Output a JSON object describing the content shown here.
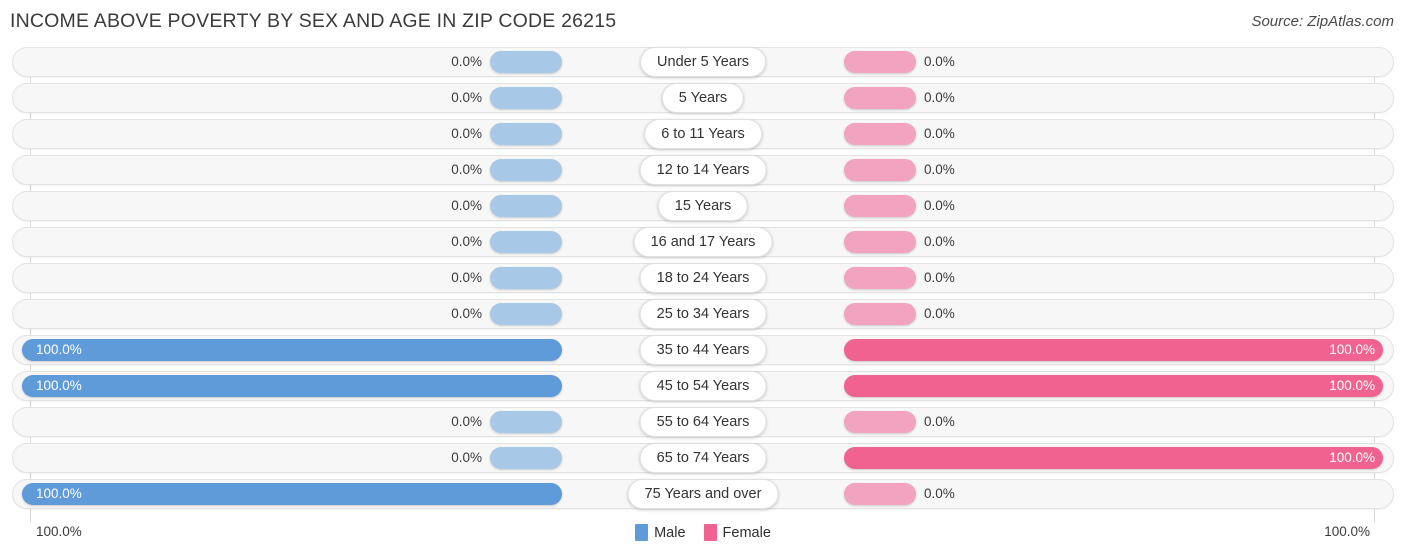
{
  "header": {
    "title": "INCOME ABOVE POVERTY BY SEX AND AGE IN ZIP CODE 26215",
    "source": "Source: ZipAtlas.com"
  },
  "legend": {
    "male_label": "Male",
    "female_label": "Female",
    "male_color": "#5f9bd9",
    "female_color": "#f0628f",
    "male_zero_color": "#a8c8e8",
    "female_zero_color": "#f2a3bf"
  },
  "axis": {
    "left_label": "100.0%",
    "right_label": "100.0%",
    "max": 100.0
  },
  "chart_data": {
    "type": "bar",
    "orientation": "horizontal-diverging",
    "title": "INCOME ABOVE POVERTY BY SEX AND AGE IN ZIP CODE 26215",
    "xlabel": "",
    "ylabel": "",
    "xlim": [
      0,
      100
    ],
    "grid": true,
    "legend_position": "bottom-center",
    "categories": [
      "Under 5 Years",
      "5 Years",
      "6 to 11 Years",
      "12 to 14 Years",
      "15 Years",
      "16 and 17 Years",
      "18 to 24 Years",
      "25 to 34 Years",
      "35 to 44 Years",
      "45 to 54 Years",
      "55 to 64 Years",
      "65 to 74 Years",
      "75 Years and over"
    ],
    "series": [
      {
        "name": "Male",
        "values": [
          0.0,
          0.0,
          0.0,
          0.0,
          0.0,
          0.0,
          0.0,
          0.0,
          100.0,
          100.0,
          0.0,
          0.0,
          100.0
        ]
      },
      {
        "name": "Female",
        "values": [
          0.0,
          0.0,
          0.0,
          0.0,
          0.0,
          0.0,
          0.0,
          0.0,
          100.0,
          100.0,
          0.0,
          100.0,
          0.0
        ]
      }
    ]
  },
  "rows": [
    {
      "label": "Under 5 Years",
      "male": "0.0%",
      "female": "0.0%",
      "male_value": 0.0,
      "female_value": 0.0
    },
    {
      "label": "5 Years",
      "male": "0.0%",
      "female": "0.0%",
      "male_value": 0.0,
      "female_value": 0.0
    },
    {
      "label": "6 to 11 Years",
      "male": "0.0%",
      "female": "0.0%",
      "male_value": 0.0,
      "female_value": 0.0
    },
    {
      "label": "12 to 14 Years",
      "male": "0.0%",
      "female": "0.0%",
      "male_value": 0.0,
      "female_value": 0.0
    },
    {
      "label": "15 Years",
      "male": "0.0%",
      "female": "0.0%",
      "male_value": 0.0,
      "female_value": 0.0
    },
    {
      "label": "16 and 17 Years",
      "male": "0.0%",
      "female": "0.0%",
      "male_value": 0.0,
      "female_value": 0.0
    },
    {
      "label": "18 to 24 Years",
      "male": "0.0%",
      "female": "0.0%",
      "male_value": 0.0,
      "female_value": 0.0
    },
    {
      "label": "25 to 34 Years",
      "male": "0.0%",
      "female": "0.0%",
      "male_value": 0.0,
      "female_value": 0.0
    },
    {
      "label": "35 to 44 Years",
      "male": "100.0%",
      "female": "100.0%",
      "male_value": 100.0,
      "female_value": 100.0
    },
    {
      "label": "45 to 54 Years",
      "male": "100.0%",
      "female": "100.0%",
      "male_value": 100.0,
      "female_value": 100.0
    },
    {
      "label": "55 to 64 Years",
      "male": "0.0%",
      "female": "0.0%",
      "male_value": 0.0,
      "female_value": 0.0
    },
    {
      "label": "65 to 74 Years",
      "male": "0.0%",
      "female": "100.0%",
      "male_value": 0.0,
      "female_value": 100.0
    },
    {
      "label": "75 Years and over",
      "male": "100.0%",
      "female": "0.0%",
      "male_value": 100.0,
      "female_value": 0.0
    }
  ]
}
